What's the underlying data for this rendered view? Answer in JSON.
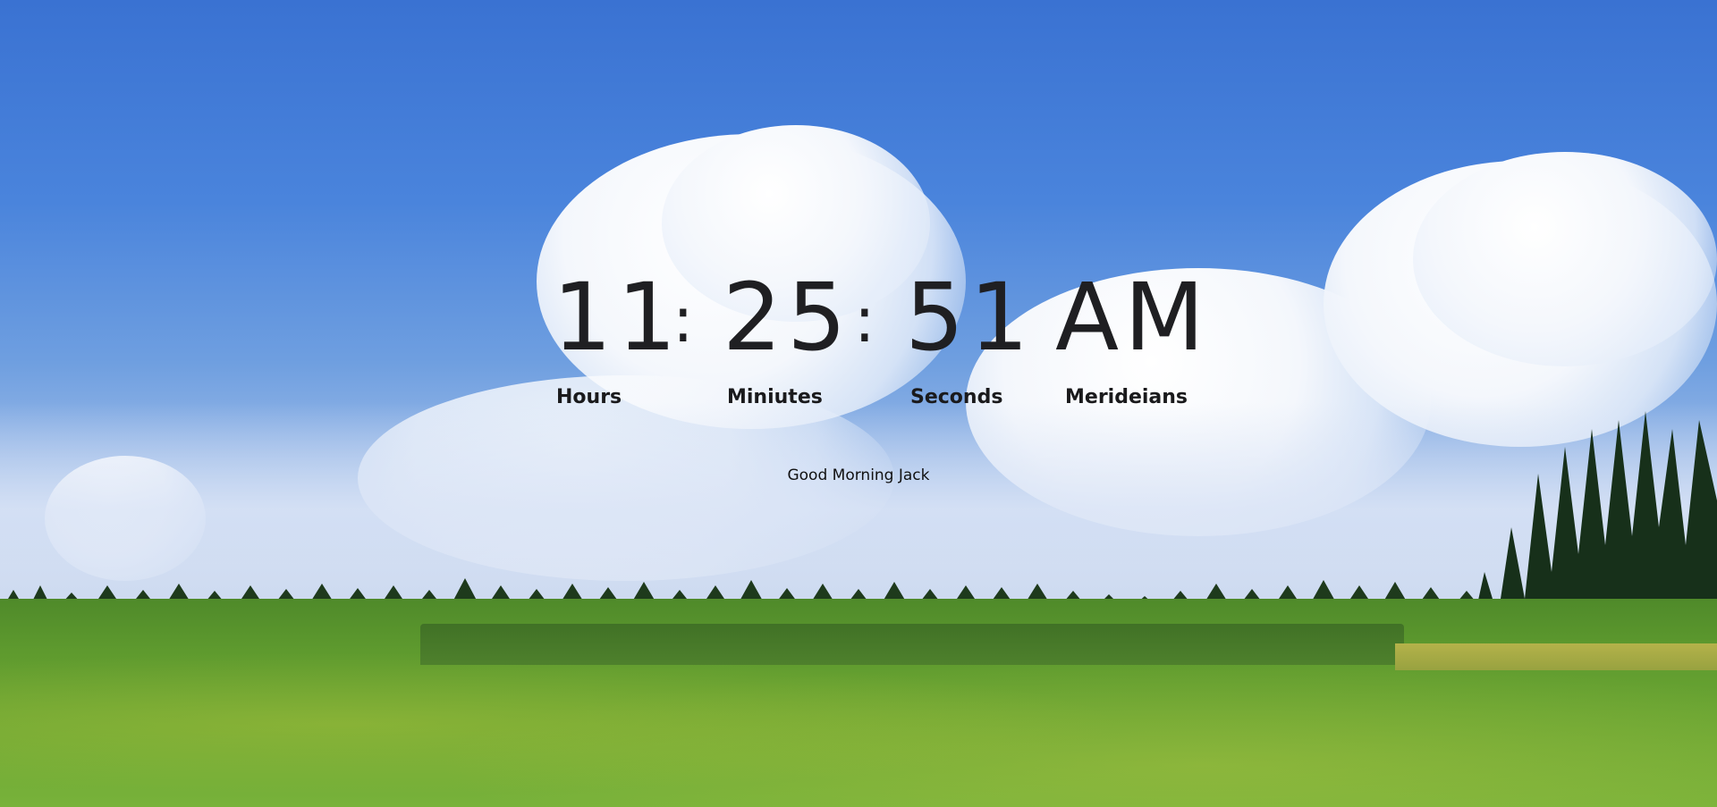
{
  "clock": {
    "hours": "11",
    "minutes": "25",
    "seconds": "51",
    "meridian": "AM",
    "separator": ":"
  },
  "labels": {
    "hours": "Hours",
    "minutes": "Miniutes",
    "seconds": "Seconds",
    "meridian": "Merideians"
  },
  "greeting": "Good Morning Jack",
  "colors": {
    "text": "#1f1f22",
    "sky": "#3a72d2",
    "grass": "#6aa533"
  }
}
